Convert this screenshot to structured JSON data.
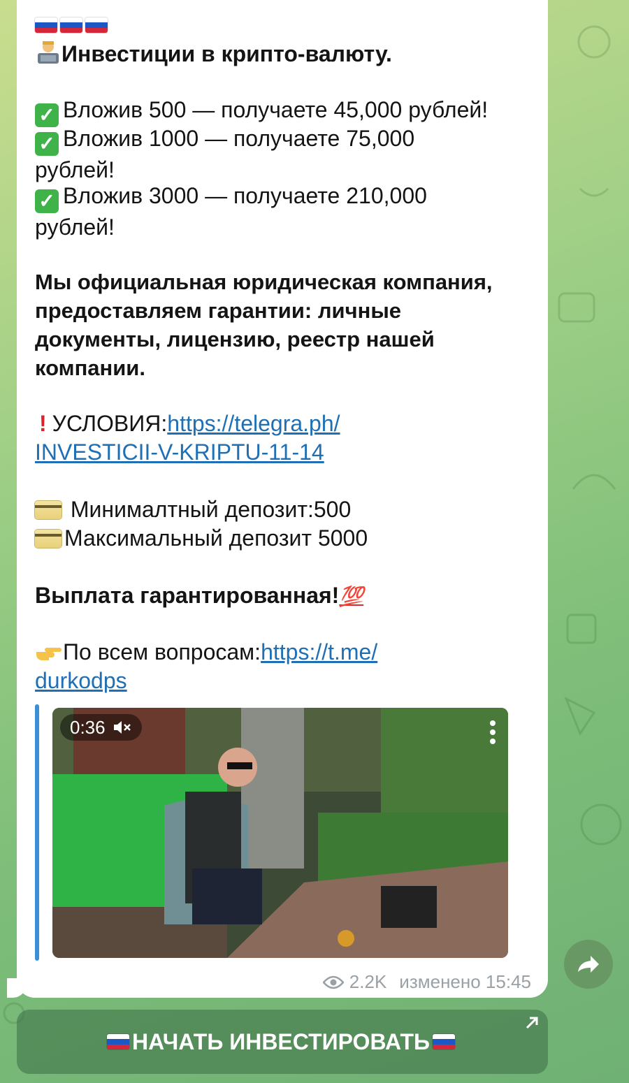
{
  "header": {
    "flags": [
      "russia-flag",
      "russia-flag",
      "russia-flag"
    ],
    "title_emoji": "technologist-icon",
    "title": "Инвестиции в крипто-валюту."
  },
  "offers": [
    {
      "line1": "Вложив 500 — получаете 45,000 рублей!",
      "line2": ""
    },
    {
      "line1": "Вложив 1000 — получаете 75,000",
      "line2": "рублей!"
    },
    {
      "line1": "Вложив 3000 — получаете 210,000",
      "line2": "рублей!"
    }
  ],
  "company_text": {
    "lines": [
      "Мы официальная юридическая компания,",
      "предоставляем гарантии: личные",
      "документы, лицензию, реестр нашей",
      "компании."
    ]
  },
  "conditions": {
    "label": "УСЛОВИЯ:",
    "link_line1": "https://telegra.ph/",
    "link_line2": "INVESTICII-V-KRIPTU-11-14"
  },
  "deposits": {
    "min": " Минималтный депозит:500",
    "max": "Максимальный депозит 5000"
  },
  "payout": {
    "text": "Выплата гарантированная!",
    "emoji_text": "💯"
  },
  "contact": {
    "label": "По всем вопросам:",
    "link_line1": "https://t.me/",
    "link_line2": "durkodps"
  },
  "video": {
    "duration": "0:36",
    "muted_icon": "speaker-muted-icon"
  },
  "meta": {
    "views": "2.2K",
    "edited": "изменено 15:45"
  },
  "action_button": {
    "label": "НАЧАТЬ ИНВЕСТИРОВАТЬ"
  },
  "colors": {
    "link": "#1f6fb5",
    "accent_bar": "#3a8fd6",
    "check_green": "#3fb349"
  }
}
